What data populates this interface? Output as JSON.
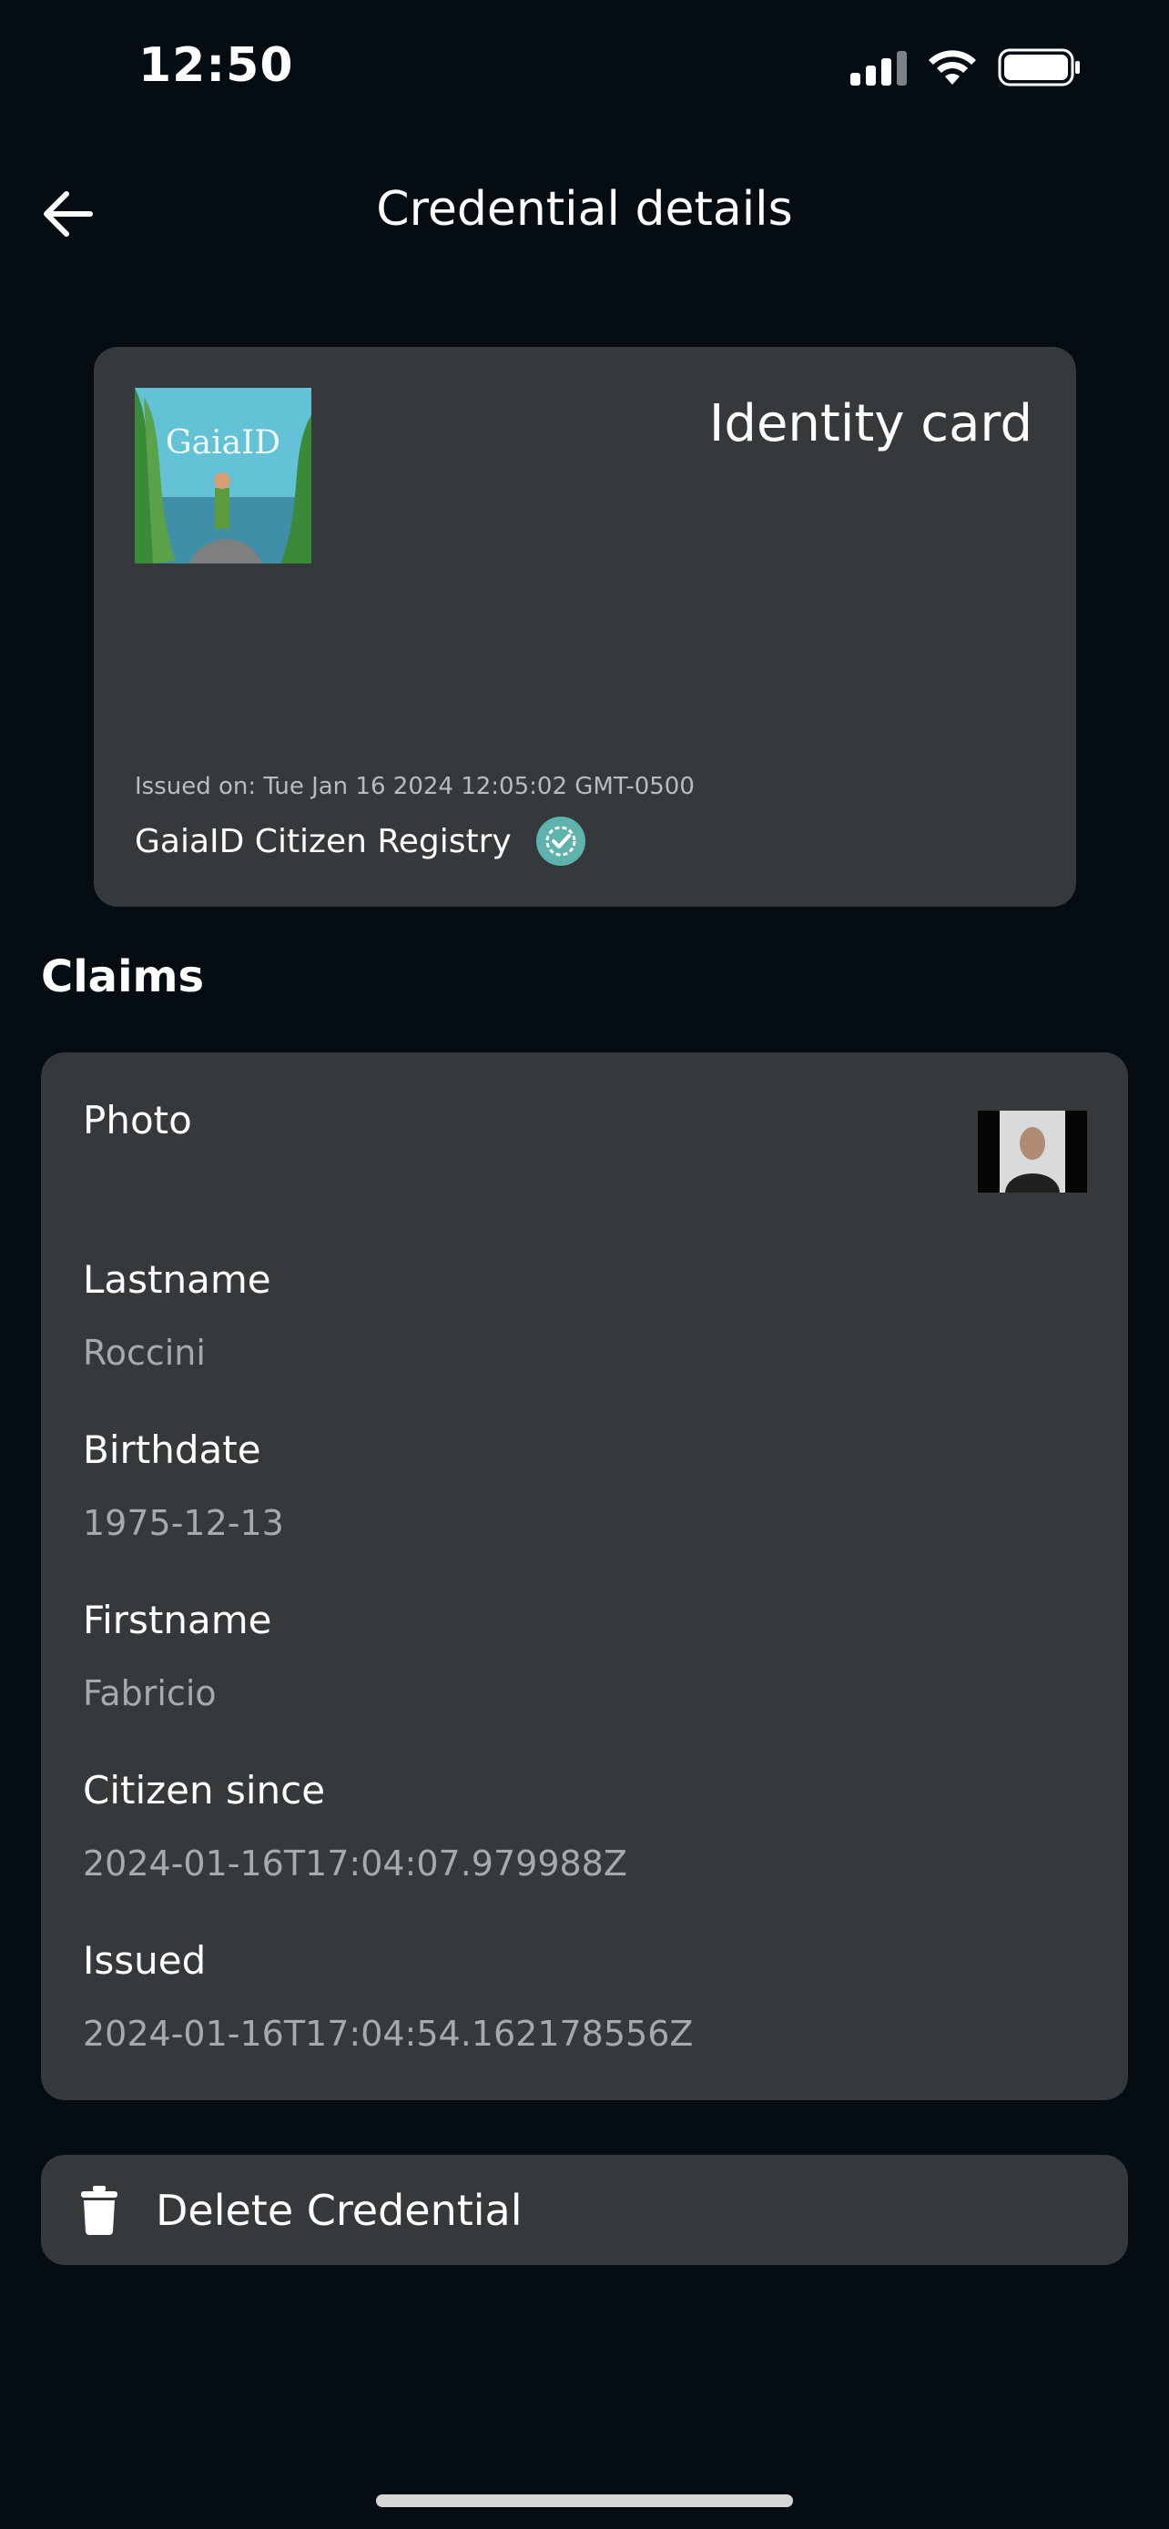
{
  "status_bar": {
    "time": "12:50",
    "battery_icon": "battery-icon",
    "wifi_icon": "wifi-icon",
    "signal_icon": "signal-icon"
  },
  "header": {
    "title": "Credential details",
    "back_icon": "arrow-left-icon"
  },
  "credential": {
    "type": "Identity card",
    "issued_on": "Issued on: Tue Jan 16 2024 12:05:02 GMT-0500",
    "issuer": "GaiaID Citizen Registry",
    "logo_text": "GaiaID",
    "verified_icon": "verified-badge-icon",
    "accent_color": "#5fb3ad"
  },
  "claims": {
    "heading": "Claims",
    "photo_label": "Photo",
    "items": [
      {
        "label": "Lastname",
        "value": "Roccini"
      },
      {
        "label": "Birthdate",
        "value": "1975-12-13"
      },
      {
        "label": "Firstname",
        "value": "Fabricio"
      },
      {
        "label": "Citizen since",
        "value": "2024-01-16T17:04:07.979988Z"
      },
      {
        "label": "Issued",
        "value": "2024-01-16T17:04:54.162178556Z"
      }
    ]
  },
  "actions": {
    "delete_label": "Delete Credential",
    "delete_icon": "trash-icon"
  },
  "colors": {
    "background": "#060d12",
    "surface": "#35393b",
    "muted_text": "#a6aaad"
  }
}
